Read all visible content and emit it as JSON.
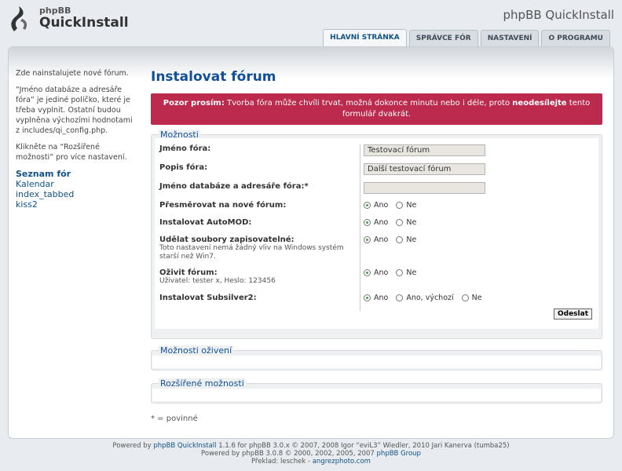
{
  "header": {
    "logo_small": "phpBB",
    "logo_big": "QuickInstall",
    "brand_title": "phpBB QuickInstall"
  },
  "tabs": [
    {
      "label": "HLAVNÍ STRÁNKA",
      "active": true
    },
    {
      "label": "SPRÁVCE FÓR",
      "active": false
    },
    {
      "label": "NASTAVENÍ",
      "active": false
    },
    {
      "label": "O PROGRAMU",
      "active": false
    }
  ],
  "sidebar": {
    "intro": "Zde nainstalujete nové fórum.",
    "note": "“Jméno databáze a adresáře fóra” je jediné políčko, které je třeba vyplnit. Ostatní budou vyplněna výchozími hodnotami z includes/qi_config.php.",
    "advanced_hint": "Klikněte na “Rozšířené možnosti” pro více nastavení.",
    "list_title": "Seznam fór",
    "boards": [
      "Kalendar",
      "index_tabbed",
      "kiss2"
    ]
  },
  "main": {
    "title": "Instalovat fórum",
    "warning_bold": "Pozor prosím:",
    "warning_text": "Tvorba fóra může chvíli trvat, možná dokonce minutu nebo i déle, proto",
    "warning_emph": "neodesílejte",
    "warning_end": "tento formulář dvakrát.",
    "options_legend": "Možnosti",
    "fields": {
      "board_name_label": "Jméno fóra:",
      "board_name_value": "Testovací fórum",
      "board_desc_label": "Popis fóra:",
      "board_desc_value": "Další testovací fórum",
      "db_name_label": "Jméno databáze a adresáře fóra:*",
      "db_name_value": "",
      "redirect_label": "Přesměrovat na nové fórum:",
      "automod_label": "Instalovat AutoMOD:",
      "writable_label": "Udělat soubory zapisovatelné:",
      "writable_hint": "Toto nastavení nemá žádný vliv na Windows systém starší než Win7.",
      "populate_label": "Oživit fórum:",
      "populate_hint": "Uživatel: tester x, Heslo: 123456",
      "subsilver_label": "Instalovat Subsilver2:",
      "yes": "Ano",
      "no": "Ne",
      "yes_default": "Ano, výchozí"
    },
    "submit_label": "Odeslat",
    "populate_legend": "Možnosti oživení",
    "advanced_legend": "Rozšířené možnosti",
    "required_note": "* = povinné"
  },
  "footer": {
    "line1_pre": "Powered by",
    "line1_link": "phpBB QuickInstall",
    "line1_post": "1.1.6 for phpBB 3.0.x © 2007, 2008 Igor “eviL3” Wiedler, 2010 Jari Kanerva (tumba25)",
    "line2_pre": "Powered by phpBB 3.0.8 © 2000, 2002, 2005, 2007",
    "line2_link": "phpBB Group",
    "line3_pre": "Překlad: leschek -",
    "line3_link": "angrezphoto.com"
  },
  "colors": {
    "accent": "#105289",
    "warning_bg": "#bc2a4d"
  }
}
